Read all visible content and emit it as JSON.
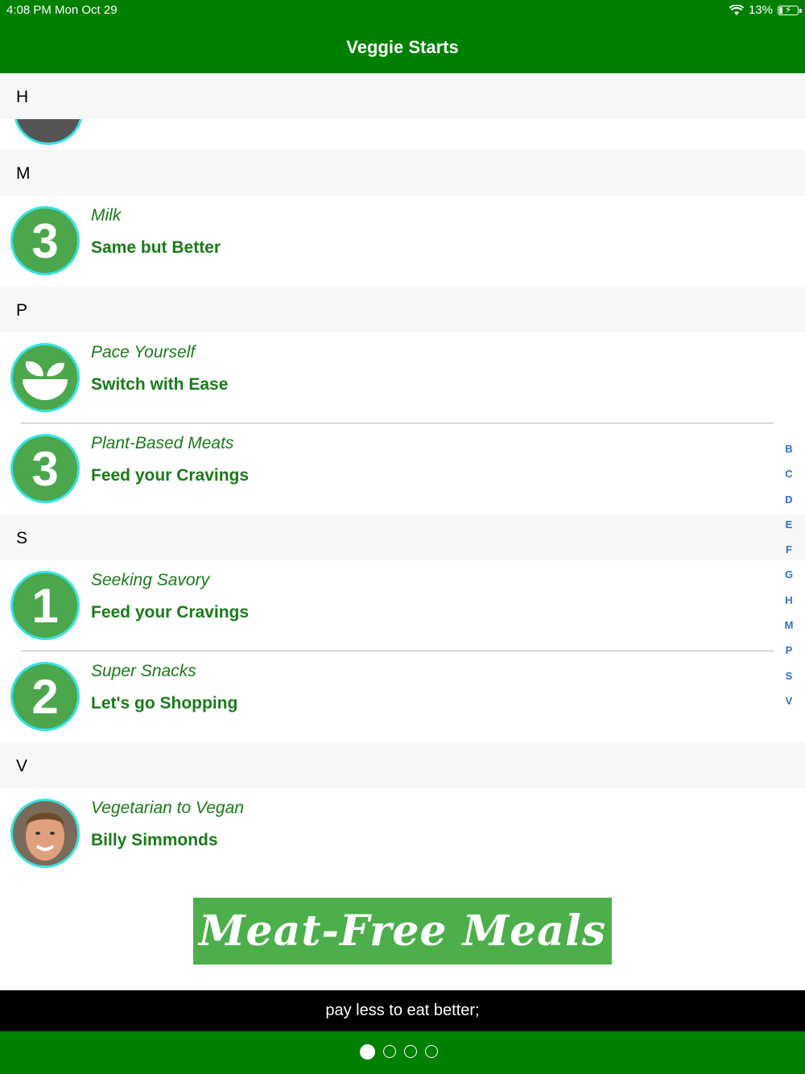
{
  "status_bar": {
    "time_date": "4:08 PM   Mon Oct 29",
    "battery": "13%"
  },
  "header": {
    "title": "Veggie Starts"
  },
  "sections": [
    {
      "letter": "H"
    },
    {
      "letter": "M",
      "rows": [
        {
          "icon": "number-3-icon",
          "badge": "3",
          "title": "Milk",
          "subtitle": "Same but Better"
        }
      ]
    },
    {
      "letter": "P",
      "rows": [
        {
          "icon": "plant-bowl-icon",
          "title": "Pace Yourself",
          "subtitle": "Switch with Ease"
        },
        {
          "icon": "number-3-icon",
          "badge": "3",
          "title": "Plant-Based Meats",
          "subtitle": "Feed your Cravings"
        }
      ]
    },
    {
      "letter": "S",
      "rows": [
        {
          "icon": "number-1-icon",
          "badge": "1",
          "title": "Seeking Savory",
          "subtitle": "Feed your Cravings"
        },
        {
          "icon": "number-2-icon",
          "badge": "2",
          "title": "Super Snacks",
          "subtitle": "Let's go Shopping"
        }
      ]
    },
    {
      "letter": "V",
      "rows": [
        {
          "icon": "person-photo",
          "title": "Vegetarian to Vegan",
          "subtitle": "Billy Simmonds"
        }
      ]
    }
  ],
  "index_letters": [
    "B",
    "C",
    "D",
    "E",
    "F",
    "G",
    "H",
    "M",
    "P",
    "S",
    "V"
  ],
  "banner": {
    "text": "Meat-Free Meals"
  },
  "tagline": "pay less to eat better;",
  "pager": {
    "pages": 4,
    "current": 1
  },
  "colors": {
    "green": "#008000",
    "accent_cyan": "#37e3e3",
    "text_green": "#1a7a1a",
    "index_blue": "#2f6fd1"
  }
}
